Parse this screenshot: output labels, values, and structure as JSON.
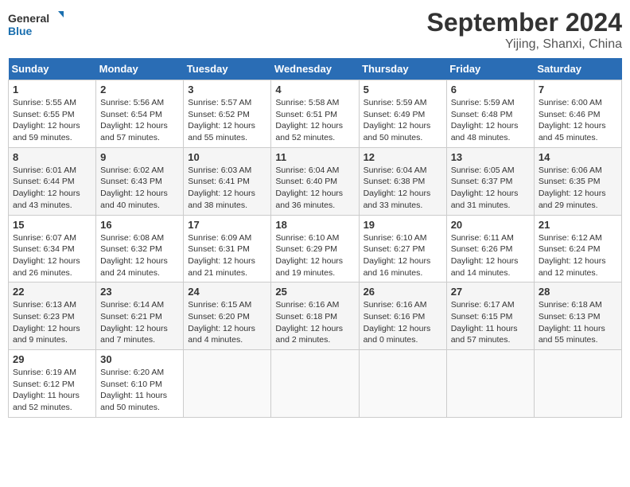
{
  "header": {
    "logo_general": "General",
    "logo_blue": "Blue",
    "month_title": "September 2024",
    "location": "Yijing, Shanxi, China"
  },
  "days_of_week": [
    "Sunday",
    "Monday",
    "Tuesday",
    "Wednesday",
    "Thursday",
    "Friday",
    "Saturday"
  ],
  "weeks": [
    [
      {
        "day": "1",
        "info": "Sunrise: 5:55 AM\nSunset: 6:55 PM\nDaylight: 12 hours\nand 59 minutes."
      },
      {
        "day": "2",
        "info": "Sunrise: 5:56 AM\nSunset: 6:54 PM\nDaylight: 12 hours\nand 57 minutes."
      },
      {
        "day": "3",
        "info": "Sunrise: 5:57 AM\nSunset: 6:52 PM\nDaylight: 12 hours\nand 55 minutes."
      },
      {
        "day": "4",
        "info": "Sunrise: 5:58 AM\nSunset: 6:51 PM\nDaylight: 12 hours\nand 52 minutes."
      },
      {
        "day": "5",
        "info": "Sunrise: 5:59 AM\nSunset: 6:49 PM\nDaylight: 12 hours\nand 50 minutes."
      },
      {
        "day": "6",
        "info": "Sunrise: 5:59 AM\nSunset: 6:48 PM\nDaylight: 12 hours\nand 48 minutes."
      },
      {
        "day": "7",
        "info": "Sunrise: 6:00 AM\nSunset: 6:46 PM\nDaylight: 12 hours\nand 45 minutes."
      }
    ],
    [
      {
        "day": "8",
        "info": "Sunrise: 6:01 AM\nSunset: 6:44 PM\nDaylight: 12 hours\nand 43 minutes."
      },
      {
        "day": "9",
        "info": "Sunrise: 6:02 AM\nSunset: 6:43 PM\nDaylight: 12 hours\nand 40 minutes."
      },
      {
        "day": "10",
        "info": "Sunrise: 6:03 AM\nSunset: 6:41 PM\nDaylight: 12 hours\nand 38 minutes."
      },
      {
        "day": "11",
        "info": "Sunrise: 6:04 AM\nSunset: 6:40 PM\nDaylight: 12 hours\nand 36 minutes."
      },
      {
        "day": "12",
        "info": "Sunrise: 6:04 AM\nSunset: 6:38 PM\nDaylight: 12 hours\nand 33 minutes."
      },
      {
        "day": "13",
        "info": "Sunrise: 6:05 AM\nSunset: 6:37 PM\nDaylight: 12 hours\nand 31 minutes."
      },
      {
        "day": "14",
        "info": "Sunrise: 6:06 AM\nSunset: 6:35 PM\nDaylight: 12 hours\nand 29 minutes."
      }
    ],
    [
      {
        "day": "15",
        "info": "Sunrise: 6:07 AM\nSunset: 6:34 PM\nDaylight: 12 hours\nand 26 minutes."
      },
      {
        "day": "16",
        "info": "Sunrise: 6:08 AM\nSunset: 6:32 PM\nDaylight: 12 hours\nand 24 minutes."
      },
      {
        "day": "17",
        "info": "Sunrise: 6:09 AM\nSunset: 6:31 PM\nDaylight: 12 hours\nand 21 minutes."
      },
      {
        "day": "18",
        "info": "Sunrise: 6:10 AM\nSunset: 6:29 PM\nDaylight: 12 hours\nand 19 minutes."
      },
      {
        "day": "19",
        "info": "Sunrise: 6:10 AM\nSunset: 6:27 PM\nDaylight: 12 hours\nand 16 minutes."
      },
      {
        "day": "20",
        "info": "Sunrise: 6:11 AM\nSunset: 6:26 PM\nDaylight: 12 hours\nand 14 minutes."
      },
      {
        "day": "21",
        "info": "Sunrise: 6:12 AM\nSunset: 6:24 PM\nDaylight: 12 hours\nand 12 minutes."
      }
    ],
    [
      {
        "day": "22",
        "info": "Sunrise: 6:13 AM\nSunset: 6:23 PM\nDaylight: 12 hours\nand 9 minutes."
      },
      {
        "day": "23",
        "info": "Sunrise: 6:14 AM\nSunset: 6:21 PM\nDaylight: 12 hours\nand 7 minutes."
      },
      {
        "day": "24",
        "info": "Sunrise: 6:15 AM\nSunset: 6:20 PM\nDaylight: 12 hours\nand 4 minutes."
      },
      {
        "day": "25",
        "info": "Sunrise: 6:16 AM\nSunset: 6:18 PM\nDaylight: 12 hours\nand 2 minutes."
      },
      {
        "day": "26",
        "info": "Sunrise: 6:16 AM\nSunset: 6:16 PM\nDaylight: 12 hours\nand 0 minutes."
      },
      {
        "day": "27",
        "info": "Sunrise: 6:17 AM\nSunset: 6:15 PM\nDaylight: 11 hours\nand 57 minutes."
      },
      {
        "day": "28",
        "info": "Sunrise: 6:18 AM\nSunset: 6:13 PM\nDaylight: 11 hours\nand 55 minutes."
      }
    ],
    [
      {
        "day": "29",
        "info": "Sunrise: 6:19 AM\nSunset: 6:12 PM\nDaylight: 11 hours\nand 52 minutes."
      },
      {
        "day": "30",
        "info": "Sunrise: 6:20 AM\nSunset: 6:10 PM\nDaylight: 11 hours\nand 50 minutes."
      },
      {
        "day": "",
        "info": ""
      },
      {
        "day": "",
        "info": ""
      },
      {
        "day": "",
        "info": ""
      },
      {
        "day": "",
        "info": ""
      },
      {
        "day": "",
        "info": ""
      }
    ]
  ]
}
